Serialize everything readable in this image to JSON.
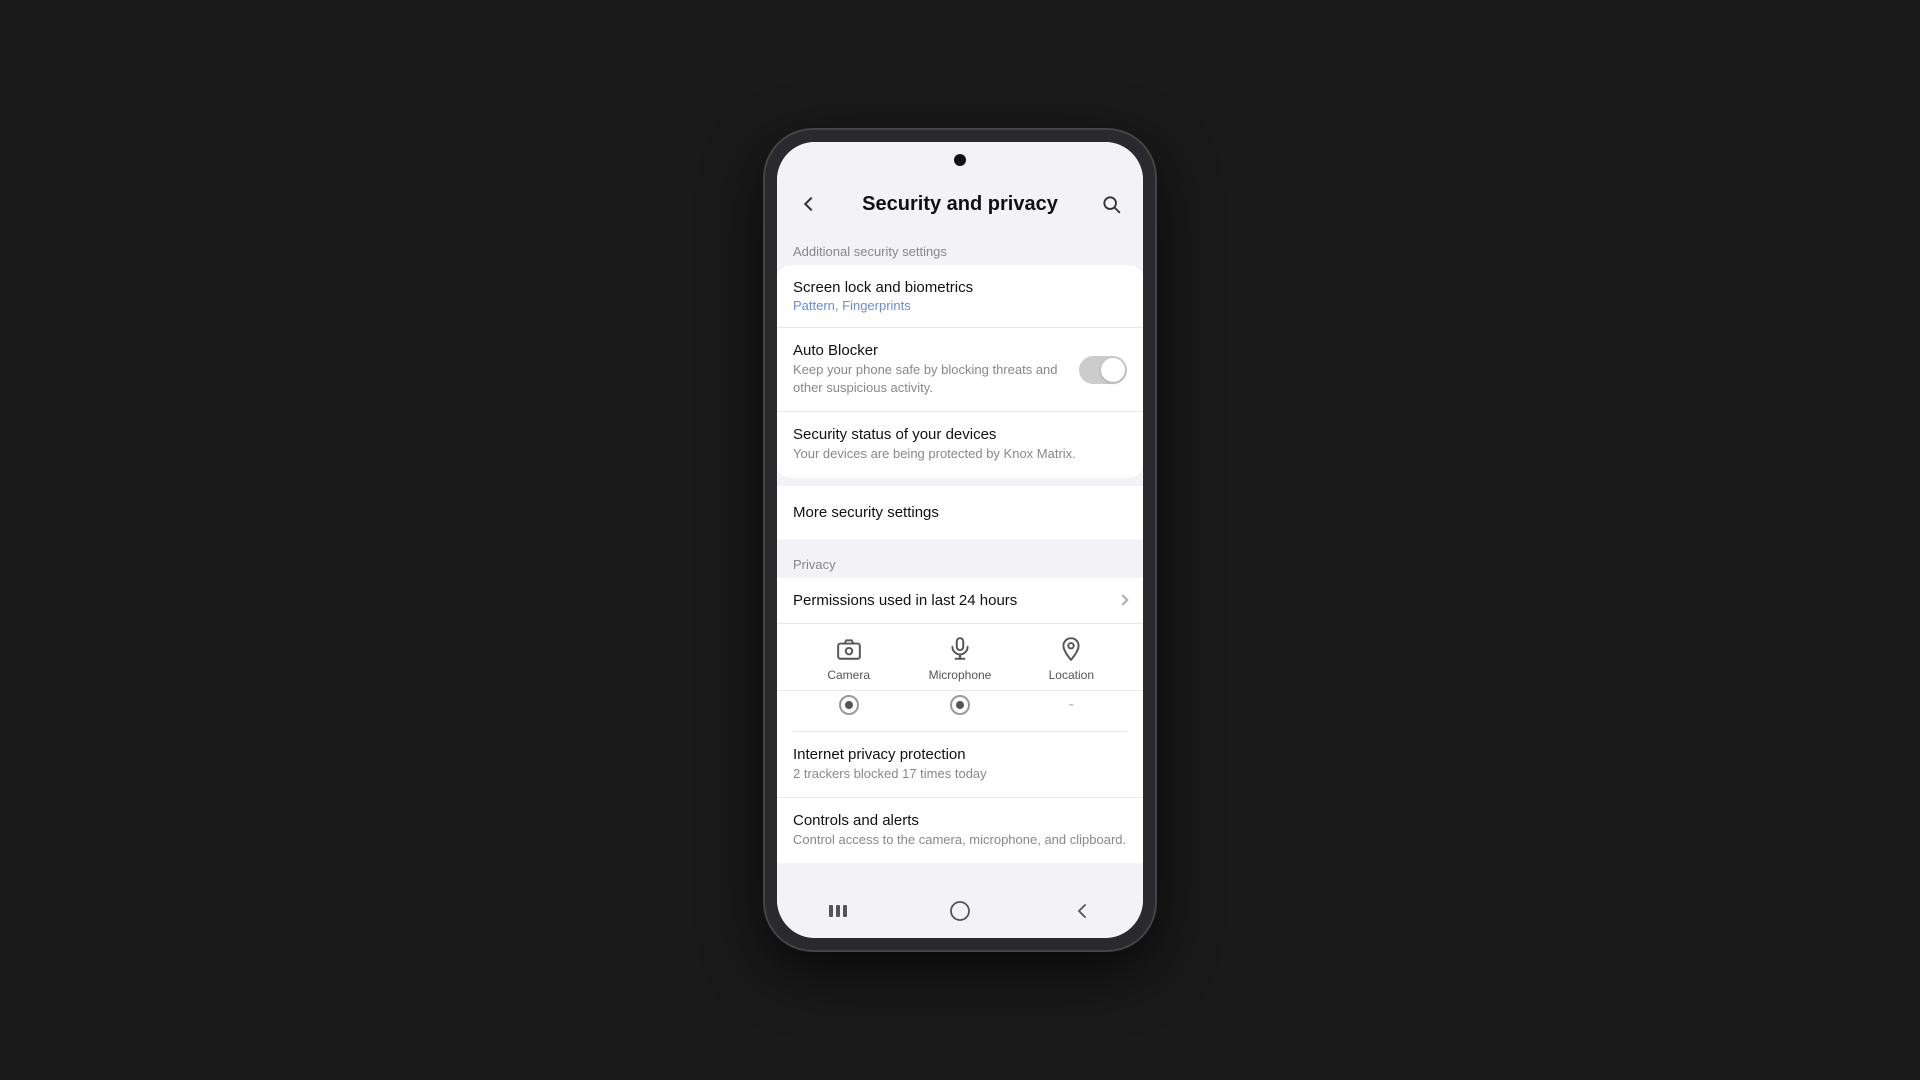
{
  "page": {
    "title": "Security and privacy",
    "back_label": "back",
    "search_label": "search"
  },
  "sections": {
    "additional_security": {
      "label": "Additional security settings",
      "items": [
        {
          "id": "screen-lock",
          "title": "Screen lock and biometrics",
          "subtitle": "Pattern, Fingerprints"
        },
        {
          "id": "auto-blocker",
          "title": "Auto Blocker",
          "desc": "Keep your phone safe by blocking threats and other suspicious activity.",
          "toggle": false
        },
        {
          "id": "security-status",
          "title": "Security status of your devices",
          "desc": "Your devices are being protected by Knox Matrix."
        }
      ]
    },
    "more_security": {
      "label": "More security settings"
    },
    "privacy": {
      "label": "Privacy",
      "permissions": {
        "header": "Permissions used in last 24 hours",
        "items": [
          {
            "id": "camera",
            "label": "Camera",
            "has_dot": true
          },
          {
            "id": "microphone",
            "label": "Microphone",
            "has_dot": true
          },
          {
            "id": "location",
            "label": "Location",
            "has_dot": false
          }
        ]
      },
      "internet_privacy": {
        "title": "Internet privacy protection",
        "desc": "2 trackers blocked 17 times today"
      },
      "controls_alerts": {
        "title": "Controls and alerts",
        "desc": "Control access to the camera, microphone, and clipboard."
      }
    }
  },
  "nav": {
    "recent": "|||",
    "home": "○",
    "back": "<"
  }
}
